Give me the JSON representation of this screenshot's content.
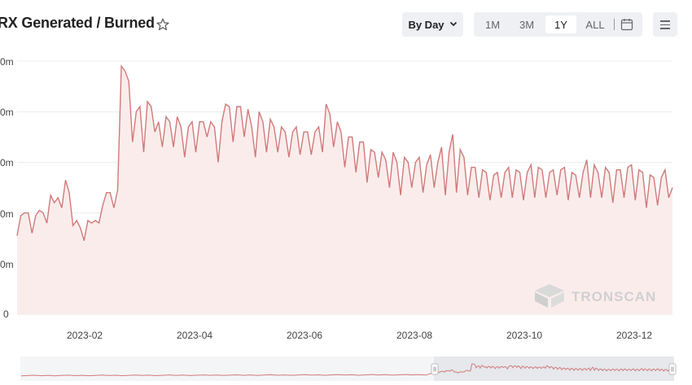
{
  "header": {
    "title": "RX Generated / Burned",
    "star_icon": "star-icon",
    "period_label": "By Day",
    "ranges": [
      "1M",
      "3M",
      "1Y",
      "ALL"
    ],
    "active_range": "1Y",
    "calendar_icon": "calendar-icon",
    "menu_icon": "hamburger-icon"
  },
  "chart_data": {
    "type": "area",
    "y_tick_labels": [
      "0m",
      "0m",
      "0m",
      "0m",
      "0m",
      "0"
    ],
    "x_tick_labels": [
      "2023-02",
      "2023-04",
      "2023-06",
      "2023-08",
      "2023-10",
      "2023-12"
    ],
    "line_color": "#d07a7a",
    "fill_color": "#fbecec",
    "grid": true,
    "note": "y tick values are cropped at the left edge; values are relative units (0 to 5 gridline steps)",
    "series": [
      {
        "values": [
          1.55,
          1.95,
          2.0,
          2.0,
          1.6,
          1.95,
          2.05,
          2.0,
          1.8,
          2.35,
          2.2,
          2.3,
          2.1,
          2.65,
          2.4,
          1.75,
          1.85,
          1.7,
          1.45,
          1.85,
          1.8,
          1.85,
          1.8,
          2.15,
          2.4,
          2.4,
          2.1,
          2.45,
          4.9,
          4.8,
          4.6,
          3.4,
          4.0,
          4.1,
          3.2,
          4.2,
          4.1,
          3.6,
          3.8,
          3.3,
          3.9,
          3.8,
          3.3,
          3.9,
          3.7,
          3.1,
          3.7,
          3.8,
          3.2,
          3.8,
          3.8,
          3.5,
          3.8,
          3.7,
          3.0,
          3.8,
          4.15,
          4.1,
          3.4,
          4.1,
          4.1,
          3.5,
          4.05,
          3.7,
          3.1,
          4.0,
          3.8,
          3.2,
          3.85,
          3.7,
          3.2,
          3.7,
          3.6,
          3.1,
          3.6,
          3.7,
          3.15,
          3.6,
          3.6,
          3.15,
          3.6,
          3.7,
          3.2,
          4.15,
          3.95,
          3.3,
          3.8,
          3.6,
          2.9,
          3.5,
          3.5,
          2.8,
          3.4,
          3.4,
          2.6,
          3.25,
          3.2,
          2.7,
          3.2,
          3.05,
          2.5,
          3.2,
          3.0,
          2.35,
          3.1,
          3.0,
          2.5,
          3.0,
          3.1,
          2.4,
          2.95,
          3.15,
          2.5,
          3.0,
          3.3,
          2.35,
          3.2,
          3.55,
          2.4,
          3.25,
          3.1,
          2.35,
          2.9,
          2.9,
          2.3,
          2.85,
          2.8,
          2.25,
          2.75,
          2.8,
          2.3,
          2.8,
          2.9,
          2.3,
          2.85,
          2.8,
          2.25,
          2.8,
          2.95,
          2.3,
          2.9,
          2.85,
          2.3,
          2.8,
          2.85,
          2.35,
          2.85,
          2.9,
          2.25,
          2.8,
          2.75,
          2.3,
          2.8,
          3.05,
          2.3,
          2.95,
          2.8,
          2.3,
          2.9,
          2.8,
          2.2,
          2.85,
          2.85,
          2.3,
          2.9,
          2.95,
          2.25,
          2.85,
          2.8,
          2.1,
          2.75,
          2.7,
          2.15,
          2.7,
          2.85,
          2.3,
          2.5
        ]
      }
    ]
  },
  "watermark": {
    "text": "TRONSCAN",
    "icon": "tronscan-logo-icon"
  }
}
